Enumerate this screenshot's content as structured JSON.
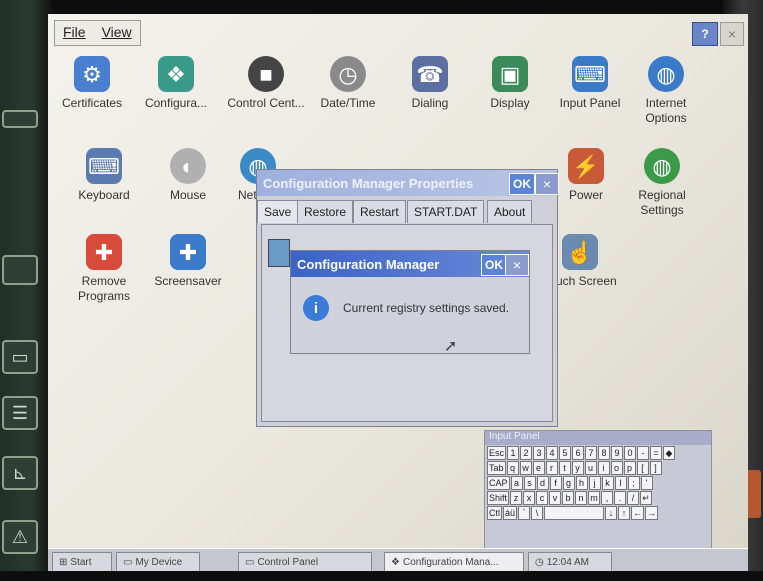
{
  "menubar": {
    "file": "File",
    "view": "View"
  },
  "titlebar_buttons": {
    "help": "?",
    "close": "×"
  },
  "icons": [
    {
      "label": "Certificates",
      "icon": "certificates-icon",
      "color": "#4a7ed0"
    },
    {
      "label": "Configura...",
      "icon": "configuration-icon",
      "color": "#3a9a8a"
    },
    {
      "label": "Control Cent...",
      "icon": "control-center-icon",
      "color": "#444444"
    },
    {
      "label": "Date/Time",
      "icon": "datetime-icon",
      "color": "#7a7a7a"
    },
    {
      "label": "Dialing",
      "icon": "dialing-icon",
      "color": "#5b6fa0"
    },
    {
      "label": "Display",
      "icon": "display-icon",
      "color": "#3a8a5a"
    },
    {
      "label": "Input Panel",
      "icon": "input-panel-icon",
      "color": "#3a7ac8"
    },
    {
      "label": "Internet Options",
      "icon": "internet-options-icon",
      "color": "#3a7ac8"
    },
    {
      "label": "Keyboard",
      "icon": "keyboard-icon",
      "color": "#5a7ab0"
    },
    {
      "label": "Mouse",
      "icon": "mouse-icon",
      "color": "#9a9a9a"
    },
    {
      "label": "Net Dia",
      "icon": "network-icon",
      "color": "#3a8ac8"
    },
    {
      "label": "Power",
      "icon": "power-icon",
      "color": "#c85a3a"
    },
    {
      "label": "Regional Settings",
      "icon": "regional-settings-icon",
      "color": "#3a9a4a"
    },
    {
      "label": "Remove Programs",
      "icon": "remove-programs-icon",
      "color": "#d84a3a"
    },
    {
      "label": "Screensaver",
      "icon": "screensaver-icon",
      "color": "#3a7ac8"
    },
    {
      "label": "Touch Screen",
      "icon": "touch-screen-icon",
      "color": "#6a8ab0"
    }
  ],
  "properties_dialog": {
    "title": "Configuration Manager Properties",
    "ok": "OK",
    "close": "×",
    "tabs": [
      "Save",
      "Restore",
      "Restart",
      "START.DAT",
      "About"
    ]
  },
  "message_box": {
    "title": "Configuration Manager",
    "ok": "OK",
    "close": "×",
    "message": "Current registry settings saved.",
    "info_icon": "i"
  },
  "keyboard": {
    "title": "Input Panel",
    "rows": [
      [
        "Esc",
        "1",
        "2",
        "3",
        "4",
        "5",
        "6",
        "7",
        "8",
        "9",
        "0",
        "-",
        "=",
        "◆"
      ],
      [
        "Tab",
        "q",
        "w",
        "e",
        "r",
        "t",
        "y",
        "u",
        "i",
        "o",
        "p",
        "[",
        "]"
      ],
      [
        "CAP",
        "a",
        "s",
        "d",
        "f",
        "g",
        "h",
        "j",
        "k",
        "l",
        ";",
        "'"
      ],
      [
        "Shift",
        "z",
        "x",
        "c",
        "v",
        "b",
        "n",
        "m",
        ",",
        ".",
        "/",
        "↵"
      ],
      [
        "Ctl",
        "áü",
        "`",
        "\\",
        "",
        "",
        "",
        "↓",
        "↑",
        "←",
        "→"
      ]
    ]
  },
  "taskbar": {
    "start": "Start",
    "my_device": "My Device",
    "control_panel": "Control Panel",
    "config_manager": "Configuration Mana...",
    "clock": "12:04 AM"
  },
  "hardware_buttons": [
    "◁",
    "▭",
    "☰",
    "⊾",
    "⚠"
  ]
}
